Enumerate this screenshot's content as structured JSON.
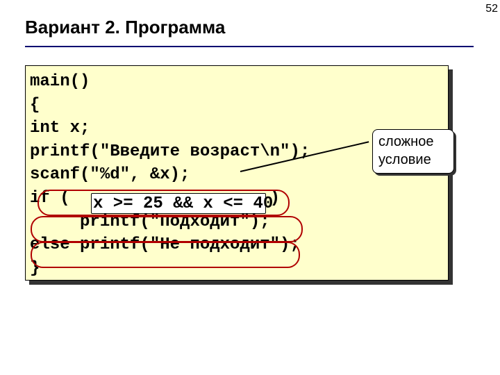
{
  "pageNumber": "52",
  "heading": "Вариант 2. Программа",
  "code": {
    "line1": "main()",
    "line2": "{",
    "line3": "int x;",
    "line4": "printf(\"Введите возраст\\n\");",
    "line5": "scanf(\"%d\", &x);",
    "line6_pre": "if ( ",
    "line6_cond": "x >= 25 && x <= 40",
    "line6_post": " )",
    "line7": "     printf(\"Подходит\");",
    "line8": "else printf(\"Не подходит\");",
    "line9": "}"
  },
  "calloutText": "сложное условие"
}
